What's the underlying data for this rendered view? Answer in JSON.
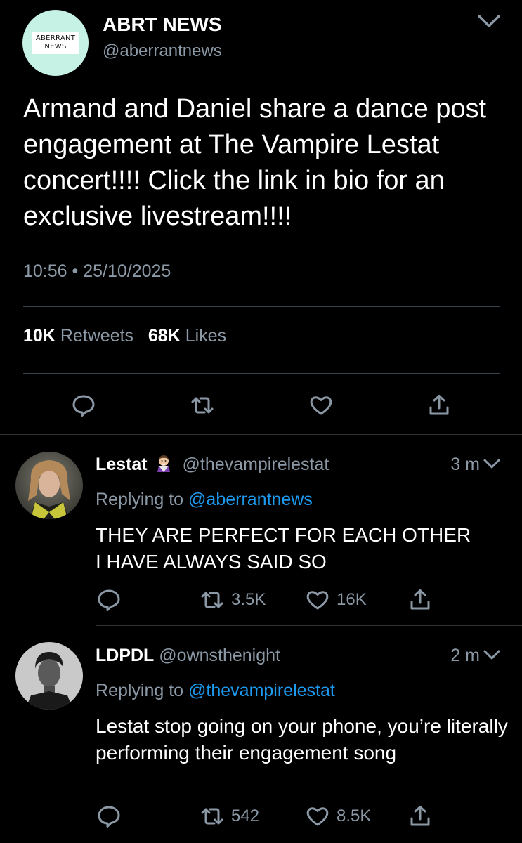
{
  "main_tweet": {
    "avatar_logo_line1": "ABERRANT",
    "avatar_logo_line2": "NEWS",
    "display_name": "ABRT NEWS",
    "handle": "@aberrantnews",
    "text": "Armand and Daniel share a dance post engagement at The Vampire Lestat concert!!!! Click the link in bio for an exclusive livestream!!!!",
    "timestamp": "10:56 • 25/10/2025",
    "retweets_count": "10K",
    "retweets_label": "Retweets",
    "likes_count": "68K",
    "likes_label": "Likes",
    "icons": [
      "reply-icon",
      "retweet-icon",
      "like-icon",
      "share-icon"
    ]
  },
  "replies": [
    {
      "display_name": "Lestat",
      "emoji": "vampire-emoji",
      "handle": "@thevampirelestat",
      "time": "3 m",
      "replying_label": "Replying to",
      "replying_to": "@aberrantnews",
      "text_line1": "THEY ARE PERFECT FOR EACH OTHER",
      "text_line2": "I HAVE ALWAYS SAID SO",
      "retweets": "3.5K",
      "likes": "16K"
    },
    {
      "display_name": "LDPDL",
      "handle": "@ownsthenight",
      "time": "2 m",
      "replying_label": "Replying to",
      "replying_to": "@thevampirelestat",
      "text": "Lestat stop going on your phone, you’re literally performing their engagement song",
      "retweets": "542",
      "likes": "8.5K"
    }
  ],
  "colors": {
    "background": "#000000",
    "secondary_text": "#8b98a5",
    "link": "#1d9bf0",
    "avatar_bg": "#c6f2e6"
  }
}
